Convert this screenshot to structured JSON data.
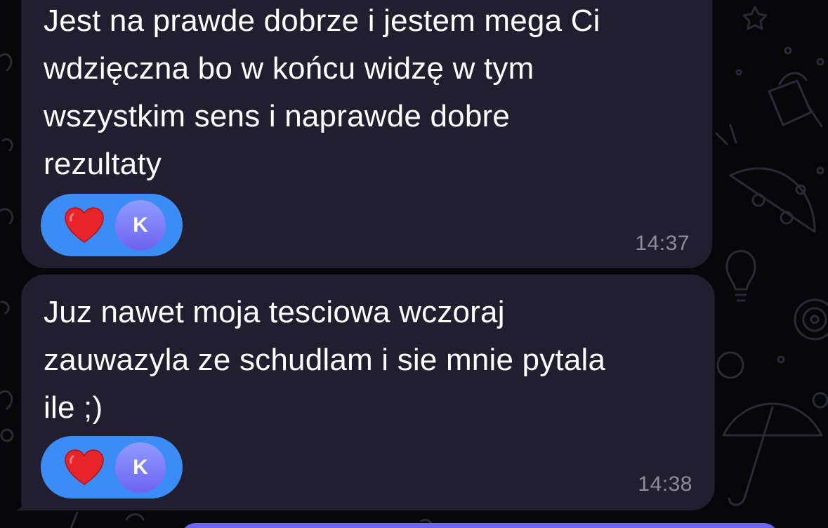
{
  "messages": [
    {
      "text": "Jest na prawde dobrze i jestem mega Ci\nwdzięczna bo w końcu widzę w tym\nwszystkim sens i naprawde dobre\nrezultaty",
      "time": "14:37",
      "reaction": {
        "emoji": "heart-icon",
        "avatar_initial": "K"
      }
    },
    {
      "text": "Juz nawet moja tesciowa wczoraj\nzauwazyla ze schudlam i sie mnie pytala\nile ;)",
      "time": "14:38",
      "reaction": {
        "emoji": "heart-icon",
        "avatar_initial": "K"
      }
    }
  ],
  "colors": {
    "background": "#07070a",
    "incoming_bubble": "#211f2f",
    "reaction_pill": "#3c8cf6",
    "heart": "#e8242b",
    "avatar_gradient_top": "#8f9cff",
    "avatar_gradient_bottom": "#6e63f0",
    "timestamp": "#8e8d99",
    "outgoing_bubble": "#6f63f5"
  }
}
